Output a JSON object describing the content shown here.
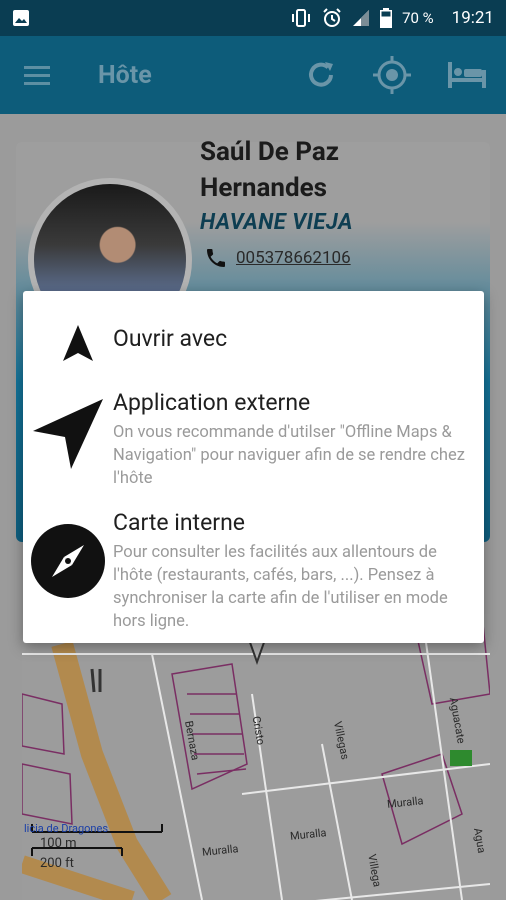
{
  "status_bar": {
    "battery_percent": "70 %",
    "time": "19:21"
  },
  "app_bar": {
    "title": "Hôte",
    "menu_icon": "hamburger-icon",
    "refresh_icon": "refresh-icon",
    "location_icon": "gps-target-icon",
    "bed_icon": "bed-icon"
  },
  "host": {
    "name": "Saúl De Paz Hernandes",
    "city": "HAVANE VIEJA",
    "phone": "005378662106"
  },
  "dialog": {
    "title": "Ouvrir avec",
    "options": [
      {
        "title": "Application externe",
        "description": "On vous recommande d'utilser \"Offline Maps & Navigation\" pour naviguer afin de se rendre chez l'hôte"
      },
      {
        "title": "Carte interne",
        "description": "Pour consulter les facilités aux allentours de l'hôte (restaurants, cafés, bars, ...). Pensez à synchroniser la carte afin de l'utiliser en mode hors ligne."
      }
    ]
  },
  "map": {
    "streets": [
      "Bernaza",
      "Cristo",
      "Villegas",
      "Aguacate",
      "Muralla",
      "Muralla",
      "Muralla",
      "Villega",
      "Agua"
    ],
    "place_label": "licia de Dragones",
    "scale_metric": "100 m",
    "scale_imperial": "200 ft"
  }
}
